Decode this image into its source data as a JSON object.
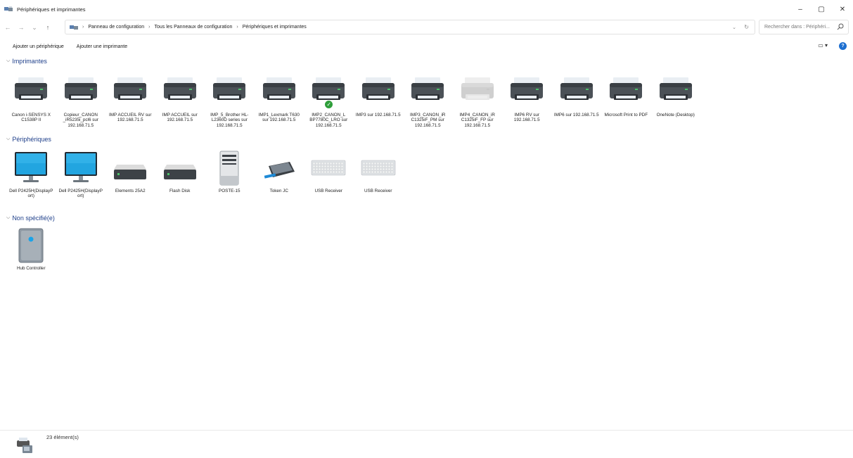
{
  "window": {
    "title": "Périphériques et imprimantes",
    "minimize": "–",
    "maximize": "▢",
    "close": "✕"
  },
  "nav": {
    "back": "←",
    "forward": "→",
    "recent": "⌄",
    "up": "↑",
    "breadcrumb": [
      "Panneau de configuration",
      "Tous les Panneaux de configuration",
      "Périphériques et imprimantes"
    ],
    "search_placeholder": "Rechercher dans : Périphéri..."
  },
  "commands": {
    "add_device": "Ajouter un périphérique",
    "add_printer": "Ajouter une imprimante"
  },
  "groups": {
    "printers": {
      "title": "Imprimantes",
      "items": [
        {
          "label": "Canon i-SENSYS X C1538P II",
          "icon": "printer-icon"
        },
        {
          "label": "Copieur_CANON _iR5235i_pcl6 sur 192.168.71.5",
          "icon": "printer-icon"
        },
        {
          "label": "IMP ACCUEIL RV sur 192.168.71.5",
          "icon": "printer-icon"
        },
        {
          "label": "IMP ACCUEIL sur 192.168.71.5",
          "icon": "printer-icon"
        },
        {
          "label": "IMP_5_Brother HL-L2360D series sur 192.168.71.5",
          "icon": "printer-icon"
        },
        {
          "label": "IMP1_Lexmark T630 sur 192.168.71.5",
          "icon": "printer-icon"
        },
        {
          "label": "IMP2_CANON_L BP7780C_LRO sur 192.168.71.5",
          "icon": "printer-icon",
          "default": true
        },
        {
          "label": "IMP3 sur 192.168.71.5",
          "icon": "printer-icon"
        },
        {
          "label": "IMP3_CANON_iR C1325iF_PM sur 192.168.71.5",
          "icon": "printer-icon"
        },
        {
          "label": "IMP4_CANON_iR C1325iF_FP sur 192.168.71.5",
          "icon": "printer-icon",
          "offline": true
        },
        {
          "label": "IMP6 RV sur 192.168.71.5",
          "icon": "printer-icon"
        },
        {
          "label": "IMP6 sur 192.168.71.5",
          "icon": "printer-icon"
        },
        {
          "label": "Microsoft Print to PDF",
          "icon": "printer-icon"
        },
        {
          "label": "OneNote (Desktop)",
          "icon": "printer-icon"
        }
      ]
    },
    "devices": {
      "title": "Périphériques",
      "items": [
        {
          "label": "Dell P2425H(DisplayP ort)",
          "icon": "monitor-icon"
        },
        {
          "label": "Dell P2425H(DisplayP ort)",
          "icon": "monitor-icon"
        },
        {
          "label": "Elements 25A2",
          "icon": "drive-icon"
        },
        {
          "label": "Flash Disk",
          "icon": "drive-icon"
        },
        {
          "label": "POSTE-15",
          "icon": "computer-icon"
        },
        {
          "label": "Token JC",
          "icon": "token-icon"
        },
        {
          "label": "USB Receiver",
          "icon": "keyboard-icon"
        },
        {
          "label": "USB Receiver",
          "icon": "keyboard-icon"
        }
      ]
    },
    "unspecified": {
      "title": "Non spécifié(e)",
      "items": [
        {
          "label": "Hub Controller",
          "icon": "hub-icon"
        }
      ]
    }
  },
  "status": {
    "count": "23 élément(s)"
  },
  "colors": {
    "accent": "#1e6fd0",
    "group_header": "#1e3f8a",
    "default_check": "#2e9e3a"
  }
}
